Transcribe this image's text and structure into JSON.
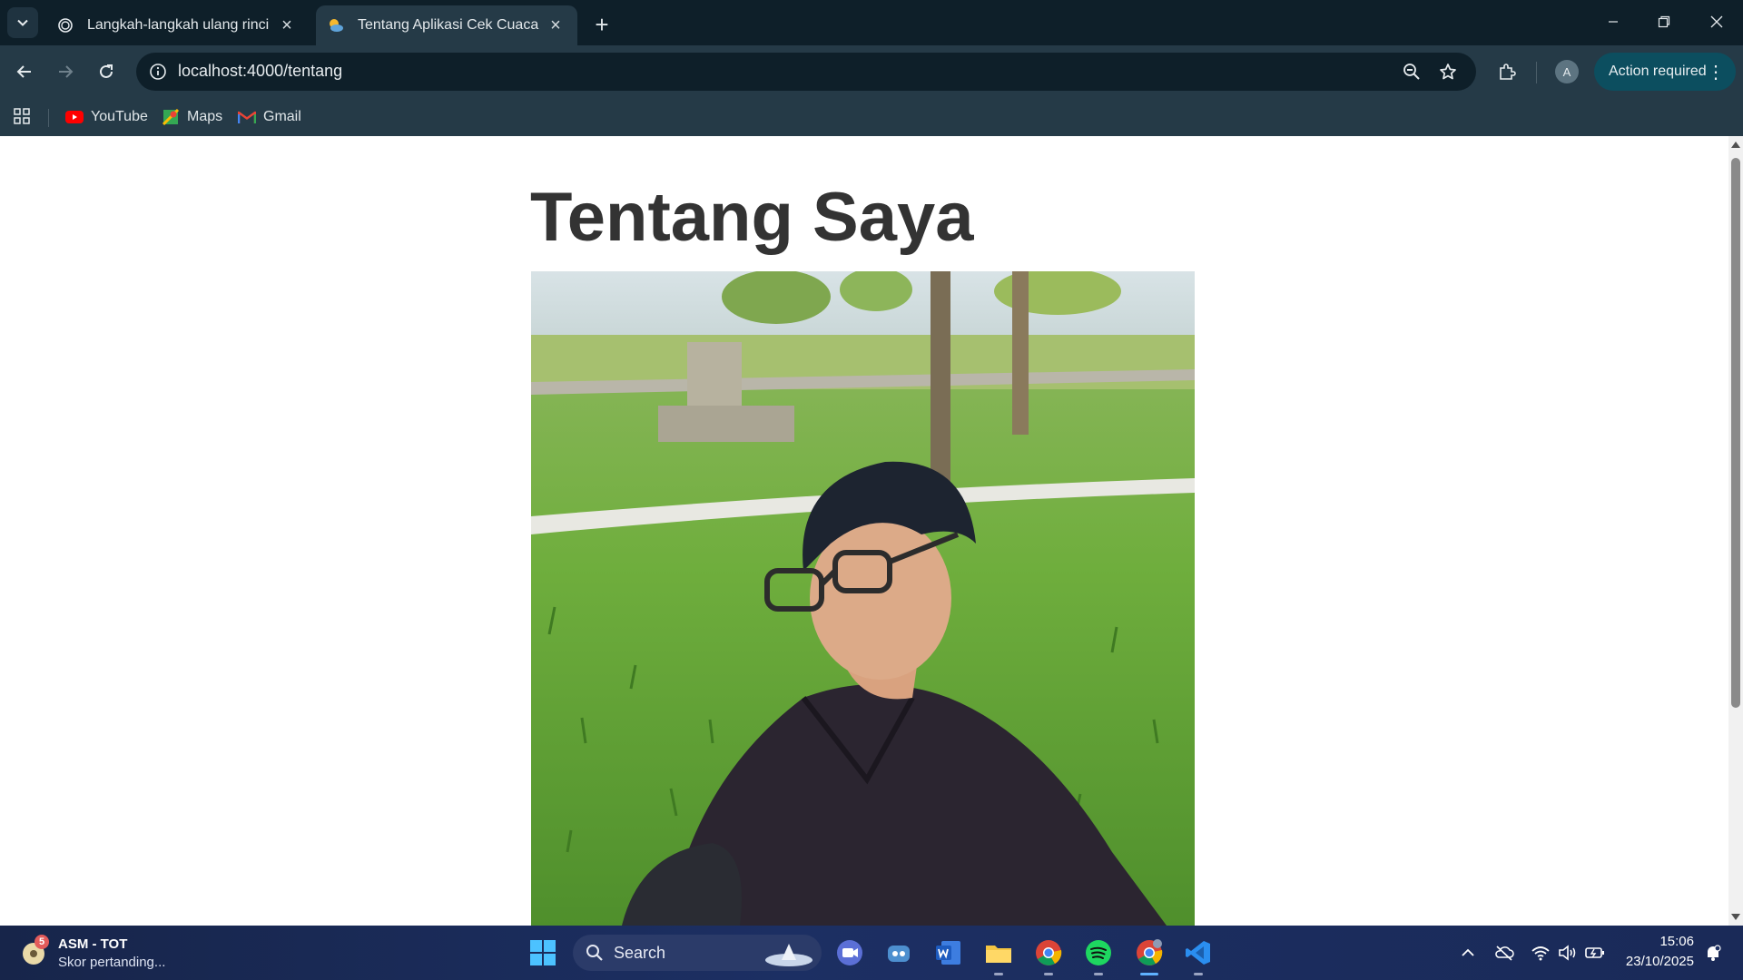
{
  "browser": {
    "tabs": [
      {
        "title": "Langkah-langkah ulang rinci",
        "icon": "chatgpt-icon",
        "active": false
      },
      {
        "title": "Tentang Aplikasi Cek Cuaca",
        "icon": "weather-icon",
        "active": true
      }
    ],
    "url": "localhost:4000/tentang",
    "action_label": "Action required",
    "avatar_letter": "A",
    "bookmarks": [
      {
        "label": "YouTube",
        "icon": "youtube-icon"
      },
      {
        "label": "Maps",
        "icon": "maps-icon"
      },
      {
        "label": "Gmail",
        "icon": "gmail-icon"
      }
    ]
  },
  "page": {
    "heading": "Tentang Saya",
    "photo": "profile-photo"
  },
  "taskbar": {
    "widget": {
      "badge": "5",
      "title": "ASM - TOT",
      "subtitle": "Skor pertanding..."
    },
    "search_label": "Search",
    "time": "15:06",
    "date": "23/10/2025",
    "accent": "#5fb2ff"
  }
}
